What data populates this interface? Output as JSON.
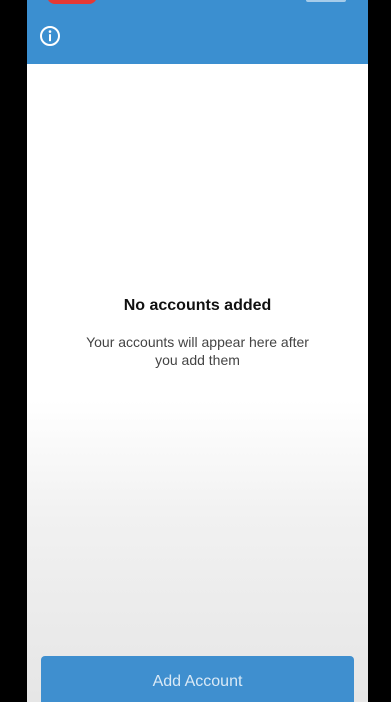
{
  "header": {
    "info_icon": "info-circle-icon",
    "accent_color": "#3b8fd0"
  },
  "empty_state": {
    "title": "No accounts added",
    "message": "Your accounts will appear here after you add them"
  },
  "footer": {
    "add_account_label": "Add Account",
    "button_color": "#3f8fcf"
  }
}
